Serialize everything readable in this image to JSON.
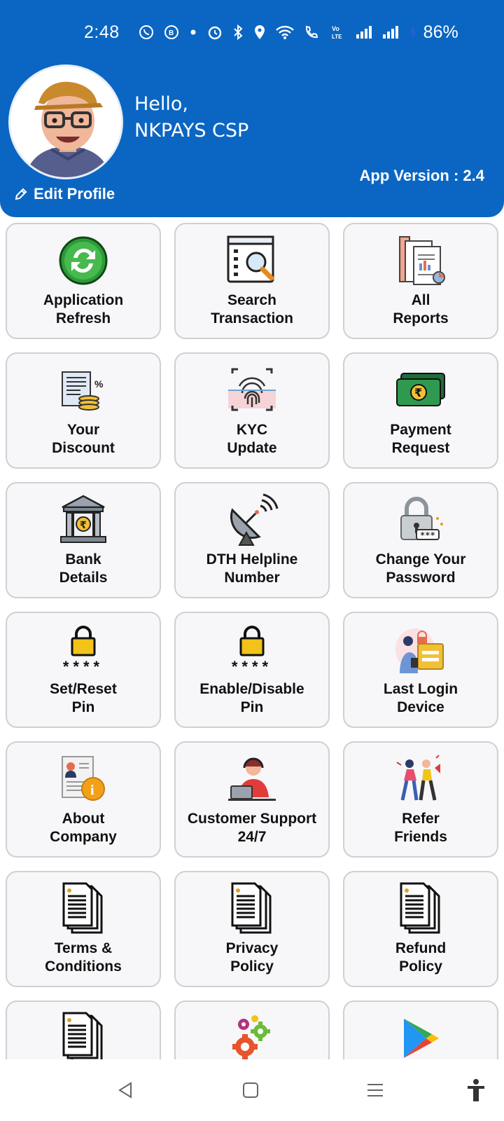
{
  "status_bar": {
    "time": "2:48",
    "battery": "86%"
  },
  "profile": {
    "greeting": "Hello,",
    "name": "NKPAYS CSP",
    "app_version": "App Version : 2.4",
    "edit_label": "Edit Profile"
  },
  "tiles": [
    {
      "line1": "Application",
      "line2": "Refresh",
      "icon": "refresh-icon"
    },
    {
      "line1": "Search",
      "line2": "Transaction",
      "icon": "search-transaction-icon"
    },
    {
      "line1": "All",
      "line2": "Reports",
      "icon": "reports-icon"
    },
    {
      "line1": "Your",
      "line2": "Discount",
      "icon": "discount-icon"
    },
    {
      "line1": "KYC",
      "line2": "Update",
      "icon": "fingerprint-icon"
    },
    {
      "line1": "Payment",
      "line2": "Request",
      "icon": "cash-icon"
    },
    {
      "line1": "Bank",
      "line2": "Details",
      "icon": "bank-icon"
    },
    {
      "line1": "DTH Helpline",
      "line2": "Number",
      "icon": "satellite-dish-icon"
    },
    {
      "line1": "Change Your",
      "line2": "Password",
      "icon": "password-lock-icon"
    },
    {
      "line1": "Set/Reset",
      "line2": "Pin",
      "icon": "pin-lock-icon"
    },
    {
      "line1": "Enable/Disable",
      "line2": "Pin",
      "icon": "pin-lock-icon"
    },
    {
      "line1": "Last Login",
      "line2": "Device",
      "icon": "login-device-icon"
    },
    {
      "line1": "About",
      "line2": "Company",
      "icon": "about-info-icon"
    },
    {
      "line1": "Customer Support",
      "line2": "24/7",
      "icon": "support-agent-icon"
    },
    {
      "line1": "Refer",
      "line2": "Friends",
      "icon": "refer-friends-icon"
    },
    {
      "line1": "Terms &",
      "line2": "Conditions",
      "icon": "document-icon"
    },
    {
      "line1": "Privacy",
      "line2": "Policy",
      "icon": "document-icon"
    },
    {
      "line1": "Refund",
      "line2": "Policy",
      "icon": "document-icon"
    },
    {
      "line1": "",
      "line2": "",
      "icon": "document-icon"
    },
    {
      "line1": "",
      "line2": "",
      "icon": "gears-icon"
    },
    {
      "line1": "",
      "line2": "",
      "icon": "play-store-icon"
    }
  ],
  "pin_mask": "****"
}
